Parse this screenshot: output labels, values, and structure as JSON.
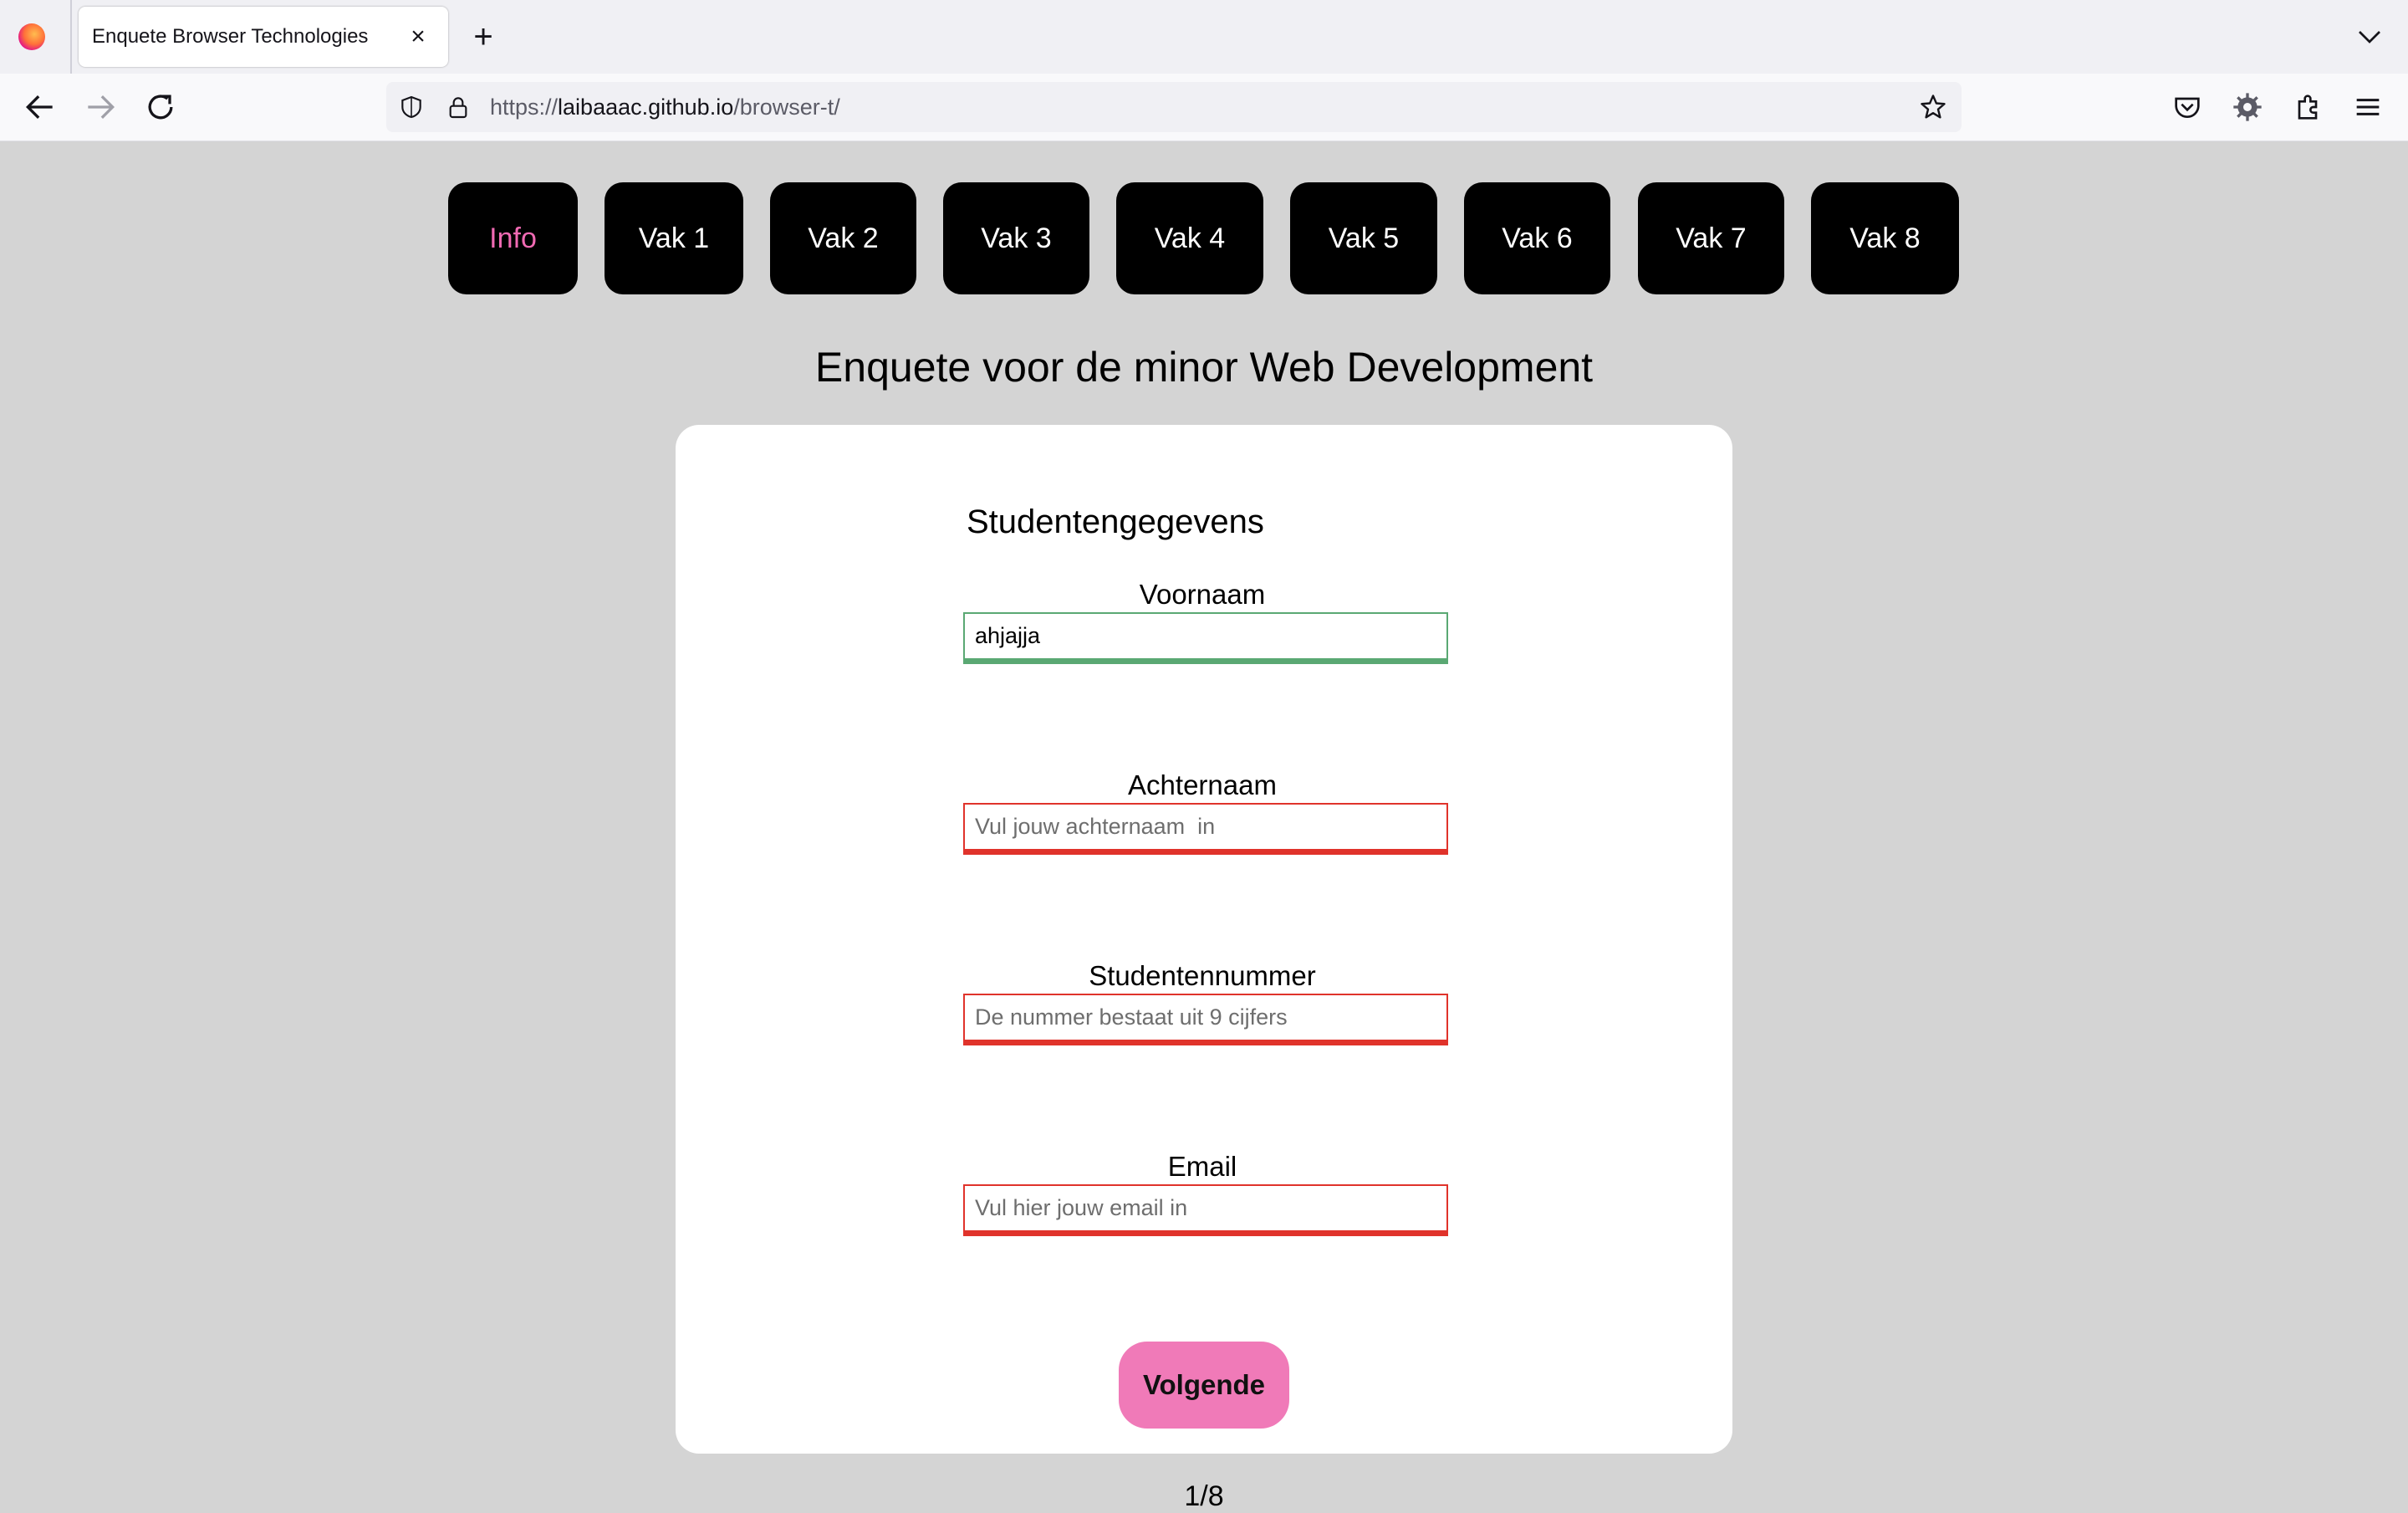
{
  "browser": {
    "tab_title": "Enquete Browser Technologies",
    "url_host_prefix": "https://",
    "url_host": "laibaaac.github.io",
    "url_path": "/browser-t/"
  },
  "nav": {
    "items": [
      {
        "label": "Info",
        "active": true
      },
      {
        "label": "Vak 1"
      },
      {
        "label": "Vak 2"
      },
      {
        "label": "Vak 3"
      },
      {
        "label": "Vak 4"
      },
      {
        "label": "Vak 5"
      },
      {
        "label": "Vak 6"
      },
      {
        "label": "Vak 7"
      },
      {
        "label": "Vak 8"
      }
    ]
  },
  "page": {
    "title": "Enquete voor de minor Web Development"
  },
  "form": {
    "section_title": "Studentengegevens",
    "fields": [
      {
        "label": "Voornaam",
        "value": "ahjajja",
        "placeholder": "",
        "status": "valid"
      },
      {
        "label": "Achternaam",
        "value": "",
        "placeholder": "Vul jouw achternaam  in",
        "status": "invalid"
      },
      {
        "label": "Studentennummer",
        "value": "",
        "placeholder": "De nummer bestaat uit 9 cijfers",
        "status": "invalid"
      },
      {
        "label": "Email",
        "value": "",
        "placeholder": "Vul hier jouw email in",
        "status": "invalid"
      }
    ],
    "next_label": "Volgende"
  },
  "pager": "1/8",
  "colors": {
    "accent": "#f07ab8",
    "active_nav_text": "#f06ab3",
    "valid": "#5aa873",
    "invalid": "#e0332b",
    "background": "#d4d4d4"
  }
}
